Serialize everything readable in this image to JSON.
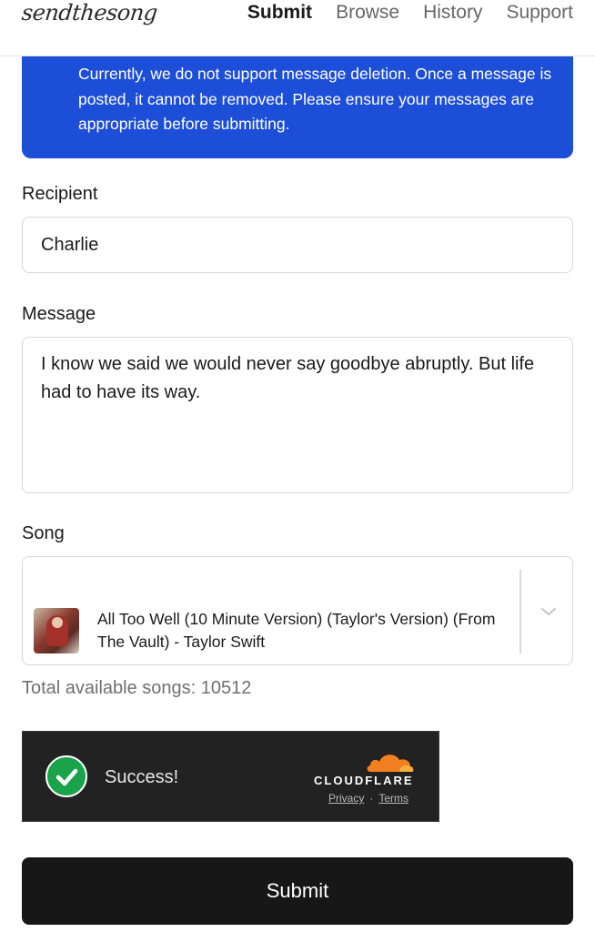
{
  "header": {
    "logo": "sendthesong",
    "nav": [
      {
        "label": "Submit",
        "active": true
      },
      {
        "label": "Browse",
        "active": false
      },
      {
        "label": "History",
        "active": false
      },
      {
        "label": "Support",
        "active": false
      }
    ]
  },
  "notice": {
    "text": "Currently, we do not support message deletion. Once a message is posted, it cannot be removed. Please ensure your messages are appropriate before submitting."
  },
  "form": {
    "recipient_label": "Recipient",
    "recipient_value": "Charlie",
    "message_label": "Message",
    "message_value": "I know we said we would never say goodbye abruptly. But life had to have its way.",
    "song_label": "Song",
    "song_selected": "All Too Well (10 Minute Version) (Taylor's Version) (From The Vault) - Taylor Swift",
    "total_songs": "Total available songs: 10512",
    "submit_label": "Submit"
  },
  "captcha": {
    "status": "Success!",
    "brand": "CLOUDFLARE",
    "privacy": "Privacy",
    "separator": "·",
    "terms": "Terms"
  },
  "colors": {
    "notice_bg": "#1d4ed8",
    "success_green": "#1aa34a",
    "cloudflare_orange": "#f38020",
    "submit_bg": "#171717"
  }
}
